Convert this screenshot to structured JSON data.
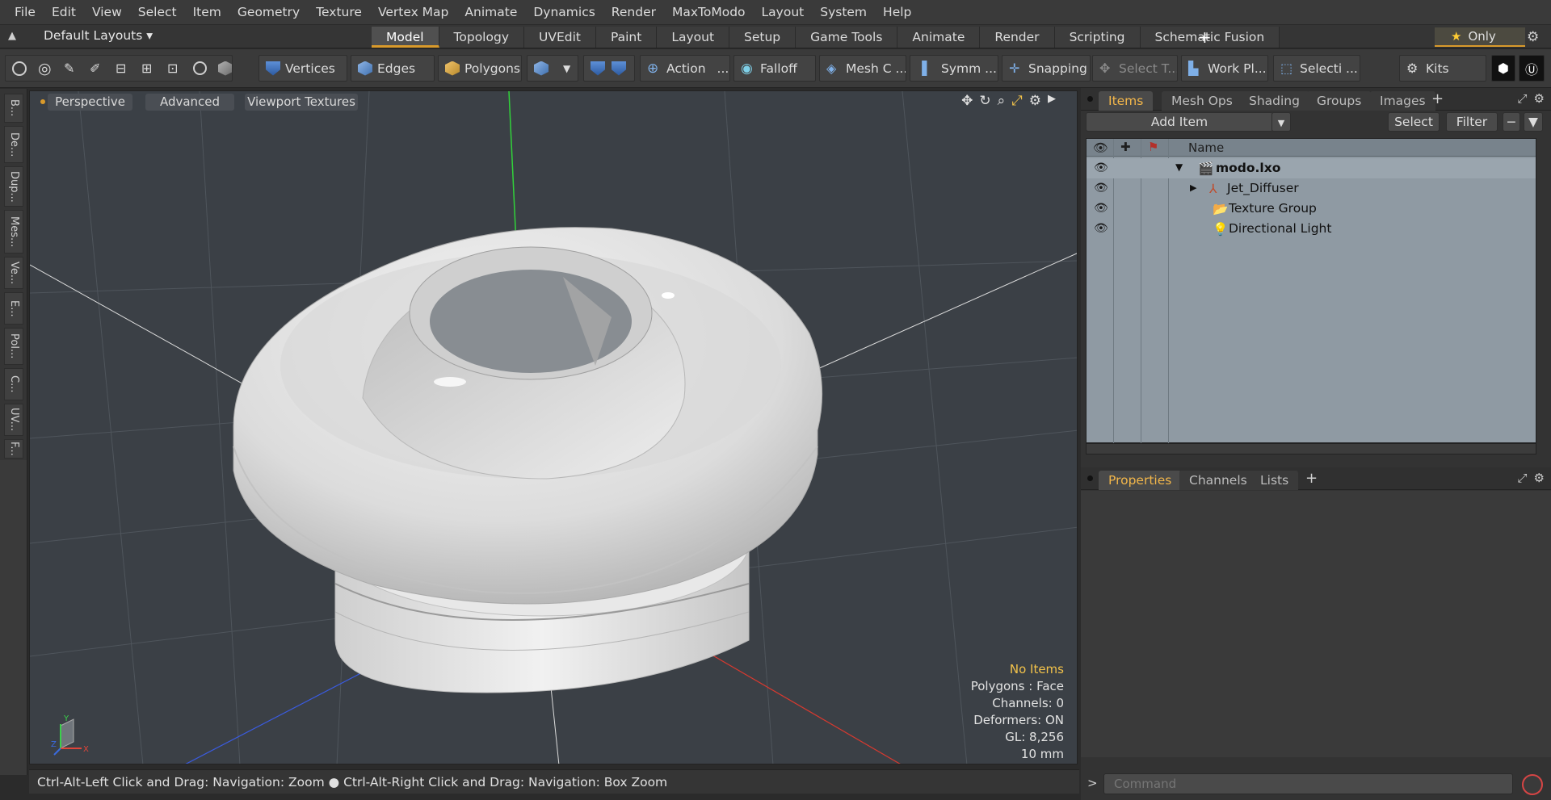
{
  "menu": [
    "File",
    "Edit",
    "View",
    "Select",
    "Item",
    "Geometry",
    "Texture",
    "Vertex Map",
    "Animate",
    "Dynamics",
    "Render",
    "MaxToModo",
    "Layout",
    "System",
    "Help"
  ],
  "layoutbar": {
    "default_layouts": "Default Layouts ▾",
    "tabs": [
      "Model",
      "Topology",
      "UVEdit",
      "Paint",
      "Layout",
      "Setup",
      "Game Tools",
      "Animate",
      "Render",
      "Scripting",
      "Schematic Fusion"
    ],
    "active_tab": "Model",
    "only_label": "Only"
  },
  "toolbar": {
    "vertices": "Vertices",
    "edges": "Edges",
    "polygons": "Polygons",
    "action": "Action",
    "action_more": "...",
    "falloff": "Falloff",
    "mesh_c": "Mesh C ...",
    "symm": "Symm ...",
    "snapping": "Snapping",
    "select_t": "Select T...",
    "work_pl": "Work Pl...",
    "selecti": "Selecti ...",
    "kits": "Kits"
  },
  "left_tabs": [
    "B...",
    "De...",
    "Dup...",
    "Mes...",
    "Ve...",
    "E...",
    "Pol...",
    "C...",
    "UV...",
    "F..."
  ],
  "viewport": {
    "perspective": "Perspective",
    "advanced": "Advanced",
    "viewport_textures": "Viewport Textures",
    "info": {
      "no_items": "No Items",
      "polygons": "Polygons : Face",
      "channels": "Channels: 0",
      "deformers": "Deformers: ON",
      "gl": "GL: 8,256",
      "scale": "10 mm"
    },
    "axis": {
      "y": "Y",
      "x": "X",
      "z": "Z"
    }
  },
  "status": {
    "part1": "Ctrl-Alt-Left Click and Drag: Navigation: Zoom",
    "part2": "Ctrl-Alt-Right Click and Drag: Navigation: Box Zoom"
  },
  "items_panel": {
    "tabs": [
      "Items",
      "Mesh Ops",
      "Shading",
      "Groups",
      "Images"
    ],
    "active_tab": "Items",
    "add_item": "Add Item",
    "select": "Select",
    "filter": "Filter",
    "name_header": "Name",
    "tree": [
      {
        "name": "modo.lxo",
        "bold": true
      },
      {
        "name": "Jet_Diffuser",
        "bold": false
      },
      {
        "name": "Texture Group",
        "bold": false
      },
      {
        "name": "Directional Light",
        "bold": false
      }
    ]
  },
  "properties_panel": {
    "tabs": [
      "Properties",
      "Channels",
      "Lists"
    ],
    "active_tab": "Properties"
  },
  "command": {
    "prompt": ">",
    "placeholder": "Command"
  },
  "colors": {
    "accent": "#d99a2b",
    "viewport_bg": "#3b4046",
    "tree_bg": "#8f9aa3"
  }
}
